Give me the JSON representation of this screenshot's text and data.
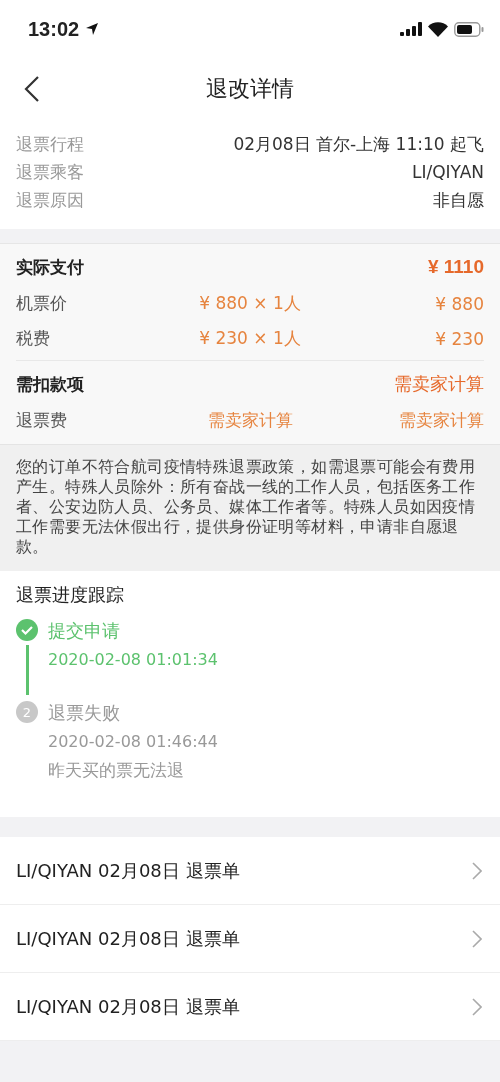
{
  "status_bar": {
    "time": "13:02"
  },
  "nav": {
    "title": "退改详情"
  },
  "info": [
    {
      "label": "退票行程",
      "value": "02月08日 首尔-上海 11:10 起飞"
    },
    {
      "label": "退票乘客",
      "value": "LI/QIYAN"
    },
    {
      "label": "退票原因",
      "value": "非自愿"
    }
  ],
  "payment": {
    "title": "实际支付",
    "total": "¥ 1110",
    "items": [
      {
        "label": "机票价",
        "detail": "¥ 880 × 1人",
        "amount": "¥ 880"
      },
      {
        "label": "税费",
        "detail": "¥ 230 × 1人",
        "amount": "¥ 230"
      }
    ]
  },
  "deduction": {
    "title": "需扣款项",
    "total": "需卖家计算",
    "items": [
      {
        "label": "退票费",
        "detail": "需卖家计算",
        "amount": "需卖家计算"
      }
    ]
  },
  "notice": "您的订单不符合航司疫情特殊退票政策，如需退票可能会有费用产生。特殊人员除外：所有奋战一线的工作人员，包括医务工作者、公安边防人员、公务员、媒体工作者等。特殊人员如因疫情工作需要无法休假出行，提供身份证明等材料，申请非自愿退款。",
  "progress": {
    "title": "退票进度跟踪",
    "steps": [
      {
        "done": true,
        "title": "提交申请",
        "time": "2020-02-08 01:01:34"
      },
      {
        "done": false,
        "number": "2",
        "title": "退票失败",
        "time": "2020-02-08 01:46:44",
        "note": "昨天买的票无法退"
      }
    ]
  },
  "documents": [
    {
      "label": "LI/QIYAN 02月08日 退票单"
    },
    {
      "label": "LI/QIYAN 02月08日 退票单"
    },
    {
      "label": "LI/QIYAN 02月08日 退票单"
    }
  ]
}
